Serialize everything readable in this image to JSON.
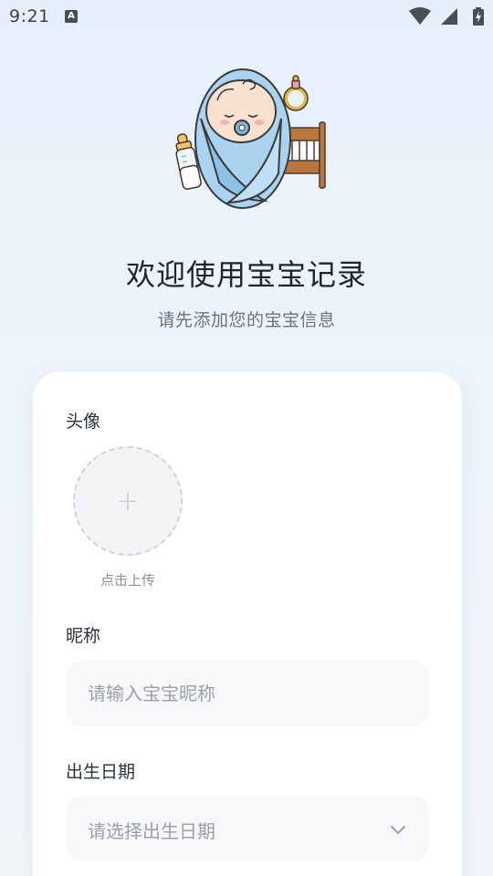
{
  "status_bar": {
    "time": "9:21",
    "notification_badge": "A",
    "icons": [
      "wifi-icon",
      "signal-icon",
      "battery-charging-icon"
    ]
  },
  "hero": {
    "illustration": "sleeping-baby-illustration",
    "title": "欢迎使用宝宝记录",
    "subtitle": "请先添加您的宝宝信息"
  },
  "form": {
    "avatar": {
      "label": "头像",
      "plus": "+",
      "hint": "点击上传"
    },
    "nickname": {
      "label": "昵称",
      "placeholder": "请输入宝宝昵称",
      "value": ""
    },
    "birth_date": {
      "label": "出生日期",
      "placeholder": "请选择出生日期",
      "icon": "chevron-down-icon"
    }
  },
  "colors": {
    "background_top": "#e6f0fb",
    "card": "#ffffff",
    "input_bg": "#f7f8fa",
    "title_text": "#1f2530",
    "secondary_text": "#6b7280",
    "placeholder_text": "#9aa0a8"
  }
}
